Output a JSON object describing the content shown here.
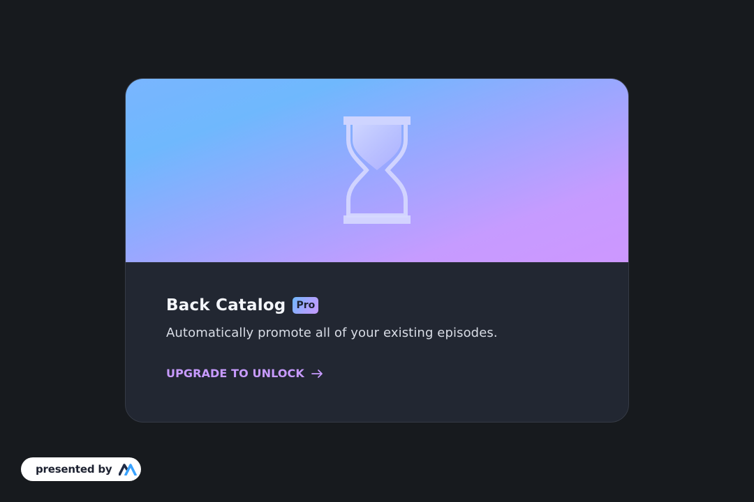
{
  "card": {
    "title": "Back Catalog",
    "badge": "Pro",
    "description": "Automatically promote all of your existing episodes.",
    "cta_label": "UPGRADE TO UNLOCK",
    "hero_icon": "hourglass-icon",
    "cta_icon": "arrow-right-icon"
  },
  "footer": {
    "presented_by": "presented by",
    "logo_icon": "brand-logo-icon"
  },
  "colors": {
    "page_background": "#171a1e",
    "card_background": "#222732",
    "hero_gradient_start": "#6fb8fd",
    "hero_gradient_end": "#cd97ff",
    "accent": "#c89bff",
    "title_text": "#f4f6fb",
    "body_text": "#d9dde6"
  }
}
